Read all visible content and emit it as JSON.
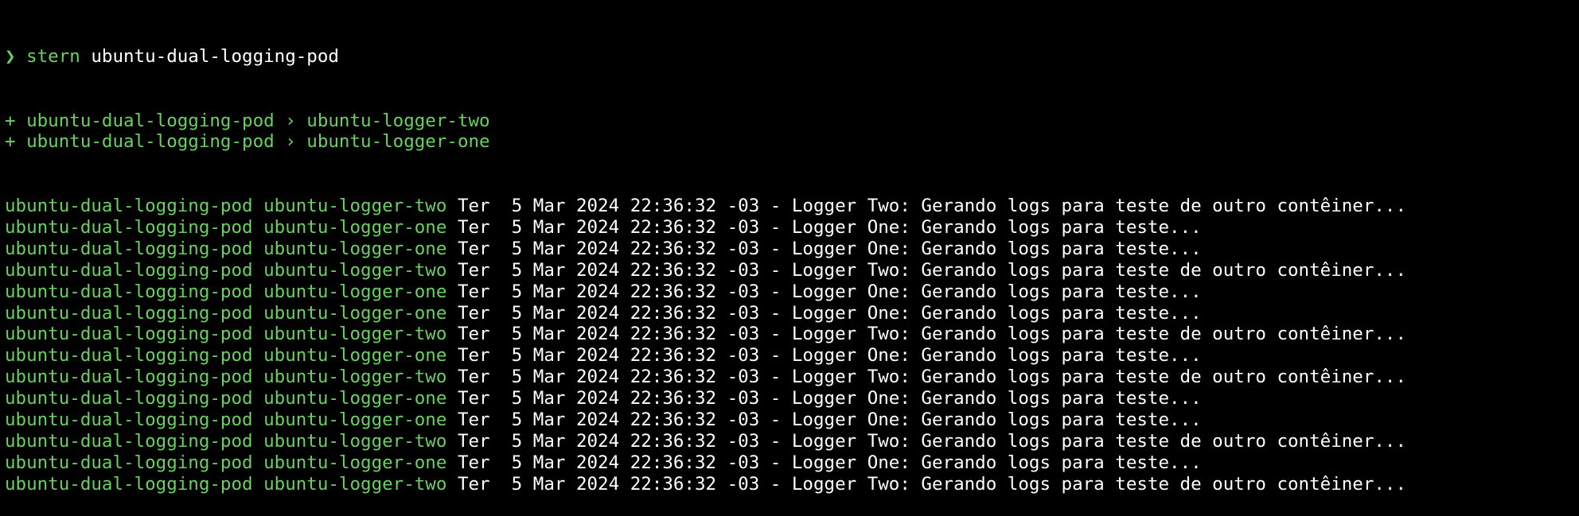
{
  "prompt": {
    "symbol": "❯",
    "command": "stern",
    "argument": "ubuntu-dual-logging-pod"
  },
  "added": [
    {
      "marker": "+",
      "pod": "ubuntu-dual-logging-pod",
      "separator": "›",
      "container": "ubuntu-logger-two"
    },
    {
      "marker": "+",
      "pod": "ubuntu-dual-logging-pod",
      "separator": "›",
      "container": "ubuntu-logger-one"
    }
  ],
  "logs": [
    {
      "pod": "ubuntu-dual-logging-pod",
      "container": "ubuntu-logger-two",
      "message": "Ter  5 Mar 2024 22:36:32 -03 - Logger Two: Gerando logs para teste de outro contêiner..."
    },
    {
      "pod": "ubuntu-dual-logging-pod",
      "container": "ubuntu-logger-one",
      "message": "Ter  5 Mar 2024 22:36:32 -03 - Logger One: Gerando logs para teste..."
    },
    {
      "pod": "ubuntu-dual-logging-pod",
      "container": "ubuntu-logger-one",
      "message": "Ter  5 Mar 2024 22:36:32 -03 - Logger One: Gerando logs para teste..."
    },
    {
      "pod": "ubuntu-dual-logging-pod",
      "container": "ubuntu-logger-two",
      "message": "Ter  5 Mar 2024 22:36:32 -03 - Logger Two: Gerando logs para teste de outro contêiner..."
    },
    {
      "pod": "ubuntu-dual-logging-pod",
      "container": "ubuntu-logger-one",
      "message": "Ter  5 Mar 2024 22:36:32 -03 - Logger One: Gerando logs para teste..."
    },
    {
      "pod": "ubuntu-dual-logging-pod",
      "container": "ubuntu-logger-one",
      "message": "Ter  5 Mar 2024 22:36:32 -03 - Logger One: Gerando logs para teste..."
    },
    {
      "pod": "ubuntu-dual-logging-pod",
      "container": "ubuntu-logger-two",
      "message": "Ter  5 Mar 2024 22:36:32 -03 - Logger Two: Gerando logs para teste de outro contêiner..."
    },
    {
      "pod": "ubuntu-dual-logging-pod",
      "container": "ubuntu-logger-one",
      "message": "Ter  5 Mar 2024 22:36:32 -03 - Logger One: Gerando logs para teste..."
    },
    {
      "pod": "ubuntu-dual-logging-pod",
      "container": "ubuntu-logger-two",
      "message": "Ter  5 Mar 2024 22:36:32 -03 - Logger Two: Gerando logs para teste de outro contêiner..."
    },
    {
      "pod": "ubuntu-dual-logging-pod",
      "container": "ubuntu-logger-one",
      "message": "Ter  5 Mar 2024 22:36:32 -03 - Logger One: Gerando logs para teste..."
    },
    {
      "pod": "ubuntu-dual-logging-pod",
      "container": "ubuntu-logger-one",
      "message": "Ter  5 Mar 2024 22:36:32 -03 - Logger One: Gerando logs para teste..."
    },
    {
      "pod": "ubuntu-dual-logging-pod",
      "container": "ubuntu-logger-two",
      "message": "Ter  5 Mar 2024 22:36:32 -03 - Logger Two: Gerando logs para teste de outro contêiner..."
    },
    {
      "pod": "ubuntu-dual-logging-pod",
      "container": "ubuntu-logger-one",
      "message": "Ter  5 Mar 2024 22:36:32 -03 - Logger One: Gerando logs para teste..."
    },
    {
      "pod": "ubuntu-dual-logging-pod",
      "container": "ubuntu-logger-two",
      "message": "Ter  5 Mar 2024 22:36:32 -03 - Logger Two: Gerando logs para teste de outro contêiner..."
    }
  ],
  "colors": {
    "background": "#000000",
    "accent_green": "#6ad160",
    "text_white": "#ffffff"
  }
}
